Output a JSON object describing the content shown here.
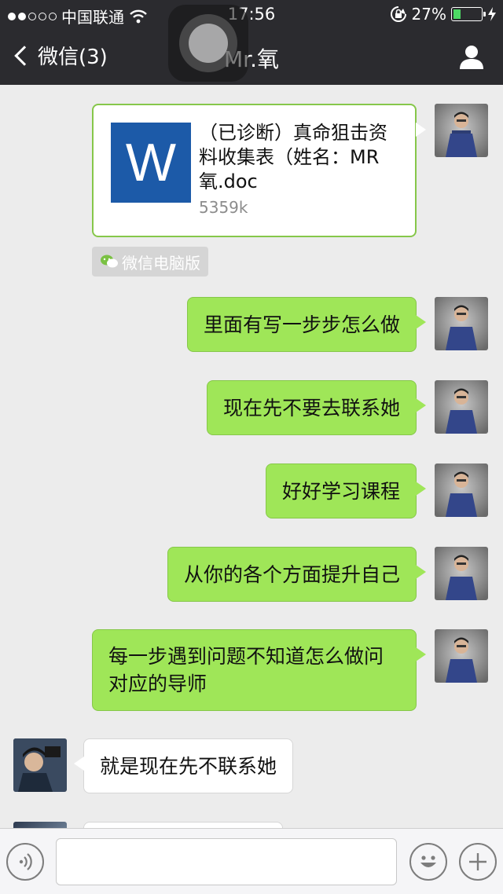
{
  "status_bar": {
    "carrier": "中国联通",
    "time": "17:56",
    "battery_percent": "27%",
    "battery_level": 0.27,
    "icons": [
      "signal-dots-icon",
      "wifi-icon",
      "rotation-lock-icon",
      "battery-icon",
      "charging-icon"
    ]
  },
  "nav": {
    "back_label": "微信(3)",
    "title": "Mr.氧",
    "icons": [
      "chevron-left-icon",
      "person-icon"
    ]
  },
  "messages": [
    {
      "type": "file",
      "sender": "self",
      "file_name": "（已诊断）真命狙击资料收集表（姓名：MR氧.doc",
      "file_size": "5359k",
      "file_icon": "W",
      "source_tag": "微信电脑版"
    },
    {
      "type": "text",
      "sender": "self",
      "text": "里面有写一步步怎么做"
    },
    {
      "type": "text",
      "sender": "self",
      "text": "现在先不要去联系她"
    },
    {
      "type": "text",
      "sender": "self",
      "text": "好好学习课程"
    },
    {
      "type": "text",
      "sender": "self",
      "text": "从你的各个方面提升自己"
    },
    {
      "type": "text",
      "sender": "self",
      "text": "每一步遇到问题不知道怎么做问对应的导师"
    },
    {
      "type": "text",
      "sender": "other",
      "text": "就是现在先不联系她"
    }
  ],
  "input_bar": {
    "placeholder": "",
    "icons": [
      "voice-icon",
      "emoji-icon",
      "plus-icon"
    ]
  },
  "colors": {
    "header_bg": "#2b2b2f",
    "chat_bg": "#ececec",
    "self_bubble": "#9fe658",
    "other_bubble": "#ffffff",
    "word_blue": "#1c5aa8",
    "battery_green": "#4cd964"
  }
}
